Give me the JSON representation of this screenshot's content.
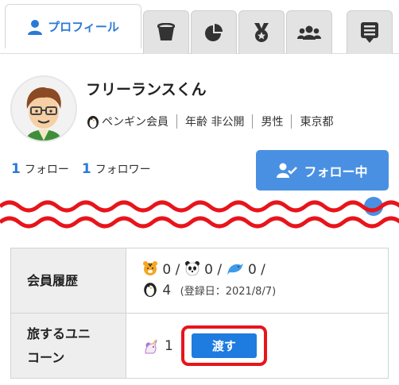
{
  "tabs": [
    {
      "label": "プロフィール",
      "icon": "user-icon",
      "active": true
    },
    {
      "label": "",
      "icon": "bucket-icon"
    },
    {
      "label": "",
      "icon": "pie-chart-icon"
    },
    {
      "label": "",
      "icon": "medal-icon"
    },
    {
      "label": "",
      "icon": "users-icon"
    },
    {
      "label": "",
      "icon": "list-icon"
    }
  ],
  "profile": {
    "name": "フリーランスくん",
    "membership": "ペンギン会員",
    "age": "年齢 非公開",
    "gender": "男性",
    "location": "東京都"
  },
  "follow": {
    "following_count": "1",
    "following_label": "フォロー",
    "followers_count": "1",
    "followers_label": "フォロワー",
    "button_label": "フォロー中"
  },
  "table": {
    "history_label": "会員履歴",
    "history_line1": "0 / ",
    "history_line1b": "0 / ",
    "history_line1c": "0 /",
    "history_count": "4",
    "history_registered": "(登録日：2021/8/7)",
    "unicorn_label_1": "旅するユニ",
    "unicorn_label_2": "コーン",
    "unicorn_count": "1",
    "pass_button": "渡す"
  },
  "colors": {
    "accent": "#4a90e2",
    "link": "#2b7ad6",
    "highlight": "#e8141b",
    "pass": "#1e7be0"
  }
}
